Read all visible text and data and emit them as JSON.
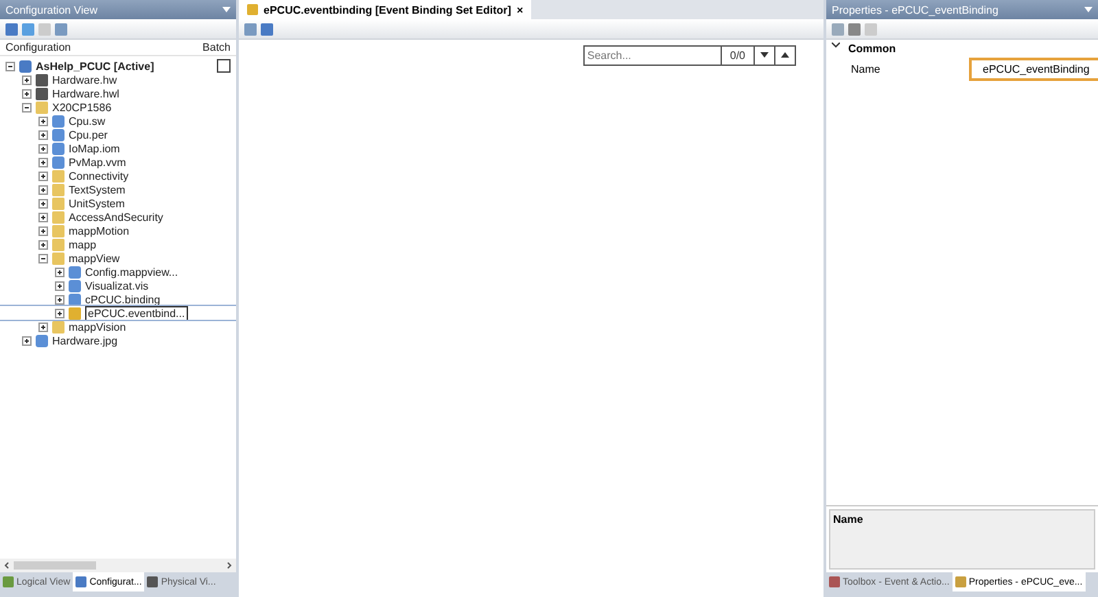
{
  "left_panel": {
    "title": "Configuration View",
    "columns": [
      "Configuration",
      "Batch"
    ],
    "tree": [
      {
        "label": "AsHelp_PCUC [Active]",
        "kind": "project",
        "expanded": true,
        "selected": false,
        "batch": false,
        "children": [
          {
            "label": "Hardware.hw",
            "kind": "hardware",
            "expanded": false,
            "selected": false
          },
          {
            "label": "Hardware.hwl",
            "kind": "hardware",
            "expanded": false,
            "selected": false
          },
          {
            "label": "X20CP1586",
            "kind": "folder",
            "expanded": true,
            "selected": false,
            "children": [
              {
                "label": "Cpu.sw",
                "kind": "file",
                "expanded": false,
                "selected": false
              },
              {
                "label": "Cpu.per",
                "kind": "file",
                "expanded": false,
                "selected": false
              },
              {
                "label": "IoMap.iom",
                "kind": "file",
                "expanded": false,
                "selected": false
              },
              {
                "label": "PvMap.vvm",
                "kind": "file",
                "expanded": false,
                "selected": false
              },
              {
                "label": "Connectivity",
                "kind": "folder",
                "expanded": false,
                "selected": false
              },
              {
                "label": "TextSystem",
                "kind": "folder",
                "expanded": false,
                "selected": false
              },
              {
                "label": "UnitSystem",
                "kind": "folder",
                "expanded": false,
                "selected": false
              },
              {
                "label": "AccessAndSecurity",
                "kind": "folder",
                "expanded": false,
                "selected": false
              },
              {
                "label": "mappMotion",
                "kind": "folder",
                "expanded": false,
                "selected": false
              },
              {
                "label": "mapp",
                "kind": "folder",
                "expanded": false,
                "selected": false
              },
              {
                "label": "mappView",
                "kind": "folder",
                "expanded": true,
                "selected": false,
                "children": [
                  {
                    "label": "Config.mappview...",
                    "kind": "file",
                    "expanded": false,
                    "selected": false
                  },
                  {
                    "label": "Visualizat.vis",
                    "kind": "file",
                    "expanded": false,
                    "selected": false
                  },
                  {
                    "label": "cPCUC.binding",
                    "kind": "file",
                    "expanded": false,
                    "selected": false
                  },
                  {
                    "label": "ePCUC.eventbind...",
                    "kind": "pencil",
                    "expanded": false,
                    "selected": true
                  }
                ]
              },
              {
                "label": "mappVision",
                "kind": "folder",
                "expanded": false,
                "selected": false
              }
            ]
          },
          {
            "label": "Hardware.jpg",
            "kind": "file",
            "expanded": false,
            "selected": false
          }
        ]
      }
    ],
    "bottom_tabs": [
      {
        "label": "Logical View",
        "selected": false
      },
      {
        "label": "Configurat...",
        "selected": true
      },
      {
        "label": "Physical Vi...",
        "selected": false
      }
    ]
  },
  "editor": {
    "tab": {
      "label": "ePCUC.eventbinding [Event Binding Set Editor]",
      "close": "×"
    },
    "search": {
      "placeholder": "Search...",
      "count": "0/0"
    }
  },
  "right_panel": {
    "title": "Properties - ePCUC_eventBinding",
    "category": "Common",
    "properties": [
      {
        "name": "Name",
        "value": "ePCUC_eventBinding"
      }
    ],
    "description_title": "Name",
    "bottom_tabs": [
      {
        "label": "Toolbox - Event & Actio...",
        "selected": false
      },
      {
        "label": "Properties - ePCUC_eve...",
        "selected": true
      }
    ]
  }
}
